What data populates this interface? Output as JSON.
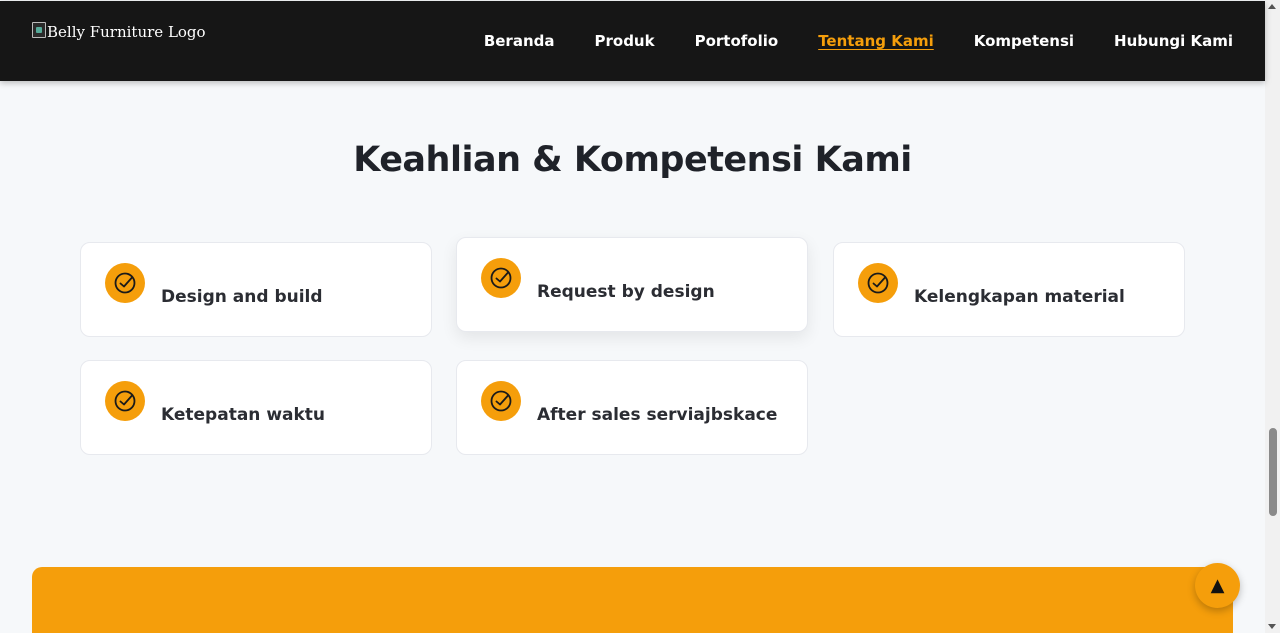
{
  "header": {
    "logo_alt": "Belly Furniture Logo",
    "nav": [
      {
        "label": "Beranda",
        "active": false
      },
      {
        "label": "Produk",
        "active": false
      },
      {
        "label": "Portofolio",
        "active": false
      },
      {
        "label": "Tentang Kami",
        "active": true
      },
      {
        "label": "Kompetensi",
        "active": false
      },
      {
        "label": "Hubungi Kami",
        "active": false
      }
    ]
  },
  "competencies": {
    "title": "Keahlian & Kompetensi Kami",
    "items": [
      {
        "label": "Design and build",
        "icon": "check-circle-icon"
      },
      {
        "label": "Request by design",
        "icon": "check-circle-icon"
      },
      {
        "label": "Kelengkapan material",
        "icon": "check-circle-icon"
      },
      {
        "label": "Ketepatan waktu",
        "icon": "check-circle-icon"
      },
      {
        "label": "After sales serviajbskace",
        "icon": "check-circle-icon"
      }
    ]
  },
  "scroll_top": {
    "label": "▲",
    "icon": "arrow-up-icon"
  },
  "colors": {
    "accent": "#f59e0b",
    "navbar_bg": "#161616",
    "page_bg": "#f6f8fa"
  }
}
